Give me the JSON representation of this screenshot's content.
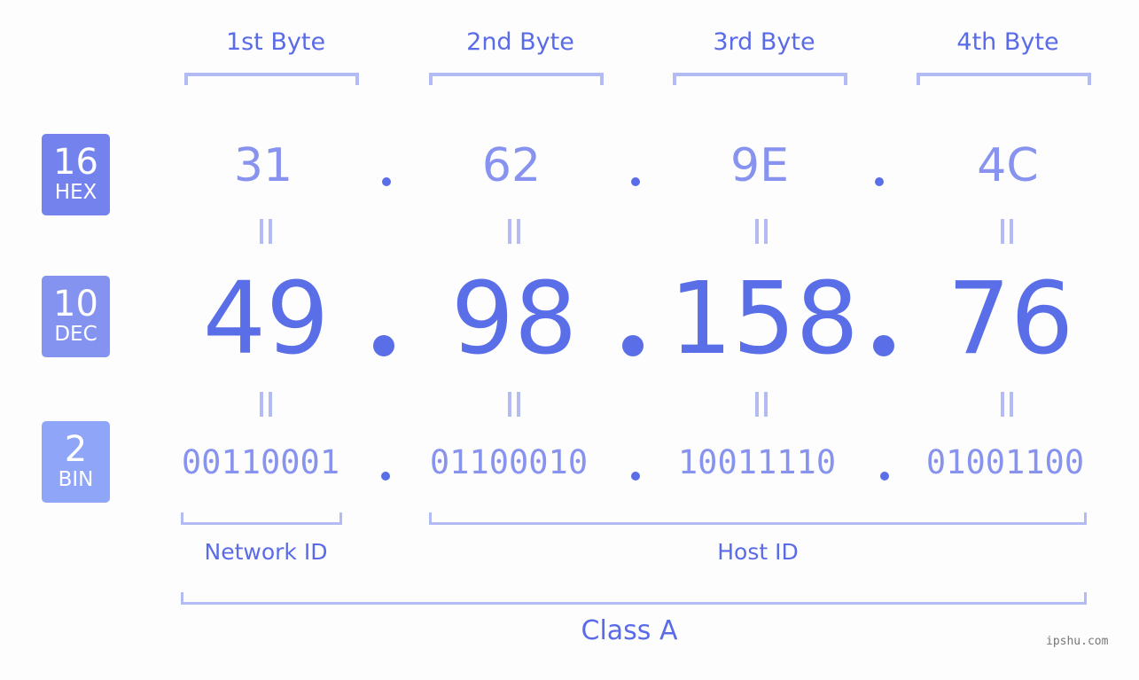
{
  "byte_headers": [
    "1st Byte",
    "2nd Byte",
    "3rd Byte",
    "4th Byte"
  ],
  "bases": [
    {
      "number": "16",
      "name": "HEX",
      "color": "#7382ec"
    },
    {
      "number": "10",
      "name": "DEC",
      "color": "#8492f0"
    },
    {
      "number": "2",
      "name": "BIN",
      "color": "#8fa6f8"
    }
  ],
  "hex": [
    "31",
    "62",
    "9E",
    "4C"
  ],
  "dec": [
    "49",
    "98",
    "158",
    "76"
  ],
  "bin": [
    "00110001",
    "01100010",
    "10011110",
    "01001100"
  ],
  "separator": ".",
  "equals": "=",
  "segments": {
    "network_id": "Network ID",
    "host_id": "Host ID"
  },
  "ip_class": "Class A",
  "watermark": "ipshu.com",
  "colors": {
    "accent": "#5a6ee8",
    "light_accent": "#8793ee",
    "bracket": "#b3bbf5",
    "background": "#fcfdfc"
  }
}
